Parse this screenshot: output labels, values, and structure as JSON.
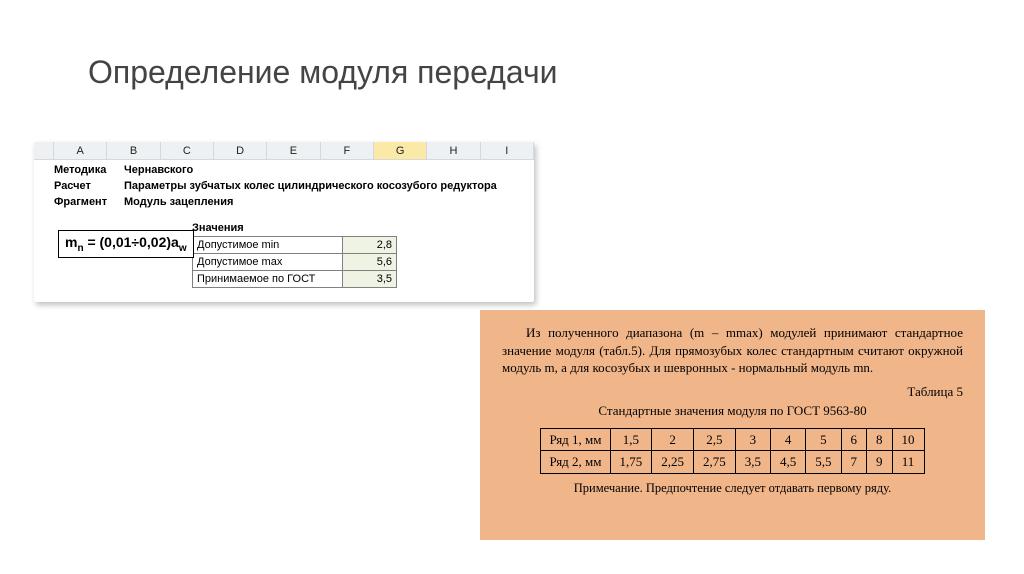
{
  "title": "Определение модуля передачи",
  "excel": {
    "columns": [
      "A",
      "B",
      "C",
      "D",
      "E",
      "F",
      "G",
      "H",
      "I"
    ],
    "selected_col": "G",
    "meta": {
      "method_label": "Методика",
      "method_value": "Чернавского",
      "calc_label": "Расчет",
      "calc_value": "Параметры зубчатых колес цилиндрического косозубого редуктора",
      "frag_label": "Фрагмент",
      "frag_value": "Модуль зацепления"
    },
    "formula_html": "m<sub>n</sub> = (0,01÷0,02)a<sub>w</sub>",
    "values_header": "Значения",
    "rows": [
      {
        "label": "Допустимое min",
        "value": "2,8"
      },
      {
        "label": "Допустимое max",
        "value": "5,6"
      },
      {
        "label": "Принимаемое по ГОСТ",
        "value": "3,5"
      }
    ]
  },
  "ref": {
    "paragraph": "Из полученного диапазона (m – mmax) модулей принимают стандартное значение модуля (табл.5). Для прямозубых колес стандартным считают окружной модуль m, а для косозубых и шевронных - нормальный модуль mn.",
    "table_label": "Таблица 5",
    "caption": "Стандартные значения модуля по ГОСТ 9563-80",
    "table": {
      "rows": [
        {
          "label": "Ряд 1, мм",
          "cells": [
            "1,5",
            "2",
            "2,5",
            "3",
            "4",
            "5",
            "6",
            "8",
            "10"
          ]
        },
        {
          "label": "Ряд 2, мм",
          "cells": [
            "1,75",
            "2,25",
            "2,75",
            "3,5",
            "4,5",
            "5,5",
            "7",
            "9",
            "11"
          ]
        }
      ]
    },
    "note": "Примечание. Предпочтение следует отдавать первому ряду."
  },
  "chart_data": {
    "type": "table",
    "title": "Стандартные значения модуля по ГОСТ 9563-80",
    "series": [
      {
        "name": "Ряд 1, мм",
        "values": [
          1.5,
          2,
          2.5,
          3,
          4,
          5,
          6,
          8,
          10
        ]
      },
      {
        "name": "Ряд 2, мм",
        "values": [
          1.75,
          2.25,
          2.75,
          3.5,
          4.5,
          5.5,
          7,
          9,
          11
        ]
      }
    ]
  }
}
